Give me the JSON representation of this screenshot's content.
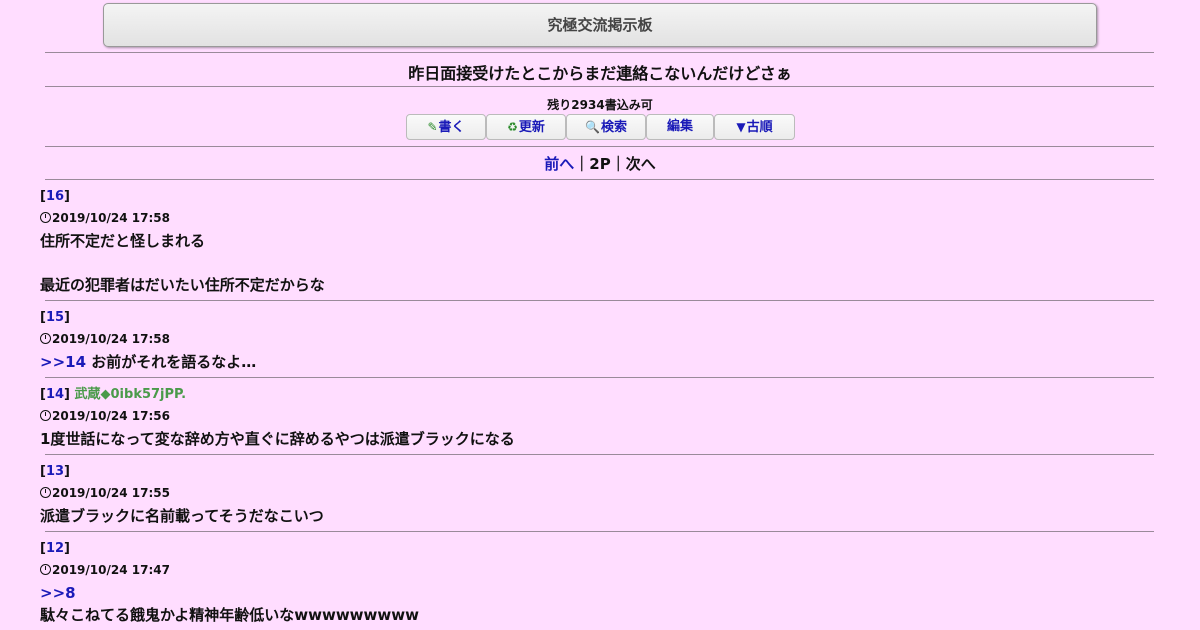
{
  "board": {
    "title": "究極交流掲示板"
  },
  "thread": {
    "title": "昨日面接受けたとこからまだ連絡こないんだけどさぁ"
  },
  "remaining": "残り2934書込み可",
  "toolbar": {
    "write": {
      "icon": "✎",
      "label": "書く"
    },
    "refresh": {
      "icon": "♻",
      "label": "更新"
    },
    "search": {
      "icon": "🔍",
      "label": "検索"
    },
    "edit": {
      "label": "編集"
    },
    "old_order": {
      "icon": "▼",
      "label": "古順"
    }
  },
  "pager": {
    "prev": "前へ",
    "sep1": "｜",
    "page": "2P",
    "sep2": "｜",
    "next": "次へ"
  },
  "posts": [
    {
      "number": "16",
      "name": "",
      "date": "2019/10/24 17:58",
      "anchor": "",
      "line1": "住所不定だと怪しまれる",
      "line2": "",
      "line3": "最近の犯罪者はだいたい住所不定だからな"
    },
    {
      "number": "15",
      "name": "",
      "date": "2019/10/24 17:58",
      "anchor": ">>14",
      "text": " お前がそれを語るなよ…"
    },
    {
      "number": "14",
      "name": "武蔵◆0ibk57jPP.",
      "date": "2019/10/24 17:56",
      "text": "1度世話になって変な辞め方や直ぐに辞めるやつは派遣ブラックになる"
    },
    {
      "number": "13",
      "name": "",
      "date": "2019/10/24 17:55",
      "text": "派遣ブラックに名前載ってそうだなこいつ"
    },
    {
      "number": "12",
      "name": "",
      "date": "2019/10/24 17:47",
      "anchor": ">>8",
      "text": "駄々こねてる餓鬼かよ精神年齢低いなwwwwwwwww"
    }
  ]
}
